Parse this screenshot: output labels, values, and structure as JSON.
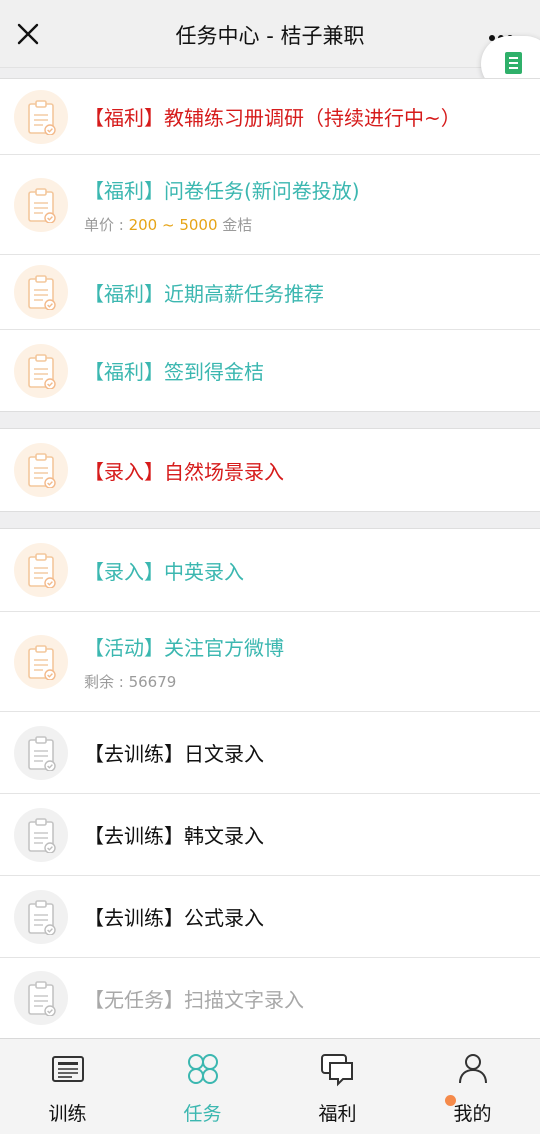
{
  "header": {
    "title": "任务中心 - 桔子兼职",
    "close_icon": "close-icon",
    "more_icon": "more-dots-icon"
  },
  "float_button": {
    "icon": "document-icon",
    "color": "#2fb06a"
  },
  "groups": [
    {
      "items": [
        {
          "title": "【福利】教辅练习册调研（持续进行中~）",
          "color": "red",
          "icon": "clipboard-orange"
        },
        {
          "title": "【福利】问卷任务(新问卷投放)",
          "color": "teal",
          "icon": "clipboard-orange",
          "sub_prefix": "单价 : ",
          "sub_value": "200 ~ 5000",
          "sub_suffix": " 金桔"
        },
        {
          "title": "【福利】近期高薪任务推荐",
          "color": "teal",
          "icon": "clipboard-orange"
        },
        {
          "title": "【福利】签到得金桔",
          "color": "teal",
          "icon": "clipboard-orange"
        }
      ]
    },
    {
      "items": [
        {
          "title": "【录入】自然场景录入",
          "color": "red",
          "icon": "clipboard-orange"
        }
      ]
    },
    {
      "items": [
        {
          "title": "【录入】中英录入",
          "color": "teal",
          "icon": "clipboard-orange"
        },
        {
          "title": "【活动】关注官方微博",
          "color": "teal",
          "icon": "clipboard-orange",
          "sub_prefix": "剩余 : ",
          "sub_value": "56679"
        },
        {
          "title": "【去训练】日文录入",
          "color": "black",
          "icon": "clipboard-grey"
        },
        {
          "title": "【去训练】韩文录入",
          "color": "black",
          "icon": "clipboard-grey"
        },
        {
          "title": "【去训练】公式录入",
          "color": "black",
          "icon": "clipboard-grey"
        },
        {
          "title": "【无任务】扫描文字录入",
          "color": "grey",
          "icon": "clipboard-grey"
        }
      ]
    }
  ],
  "tabs": [
    {
      "label": "训练",
      "icon": "newspaper-icon",
      "active": false
    },
    {
      "label": "任务",
      "icon": "four-petal-icon",
      "active": true
    },
    {
      "label": "福利",
      "icon": "chat-bubbles-icon",
      "active": false
    },
    {
      "label": "我的",
      "icon": "person-icon",
      "active": false,
      "badge": true
    }
  ],
  "colors": {
    "accent": "#3bb7b0",
    "red": "#d61b1b",
    "price": "#e6a417",
    "badge": "#f58a4a"
  }
}
